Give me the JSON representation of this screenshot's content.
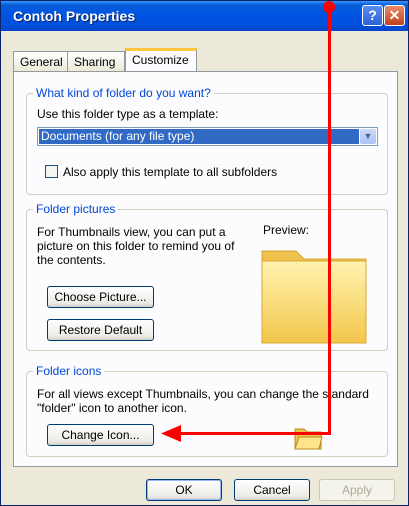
{
  "window": {
    "title": "Contoh Properties"
  },
  "titlebar": {
    "help_glyph": "?",
    "close_glyph": "✕"
  },
  "tabs": [
    {
      "label": "General"
    },
    {
      "label": "Sharing"
    },
    {
      "label": "Customize",
      "active": true
    }
  ],
  "template_group": {
    "title": "What kind of folder do you want?",
    "use_label": "Use this folder type as a template:",
    "selected_type": "Documents (for any file type)",
    "apply_subfolders_label": "Also apply this template to all subfolders",
    "apply_subfolders_checked": false
  },
  "pictures_group": {
    "title": "Folder pictures",
    "description_lines": [
      "For Thumbnails view, you can put a",
      "picture on this folder to remind you of",
      "the contents."
    ],
    "preview_label": "Preview:",
    "choose_button": "Choose Picture...",
    "restore_button": "Restore Default"
  },
  "icons_group": {
    "title": "Folder icons",
    "description_lines": [
      "For all views except Thumbnails, you can change the standard",
      "\"folder\" icon to another icon."
    ],
    "change_button": "Change Icon..."
  },
  "footer": {
    "ok": "OK",
    "cancel": "Cancel",
    "apply": "Apply"
  },
  "colors": {
    "title_bar": "#0054e3",
    "annotation": "#ff0000",
    "group_title": "#0046d5"
  }
}
